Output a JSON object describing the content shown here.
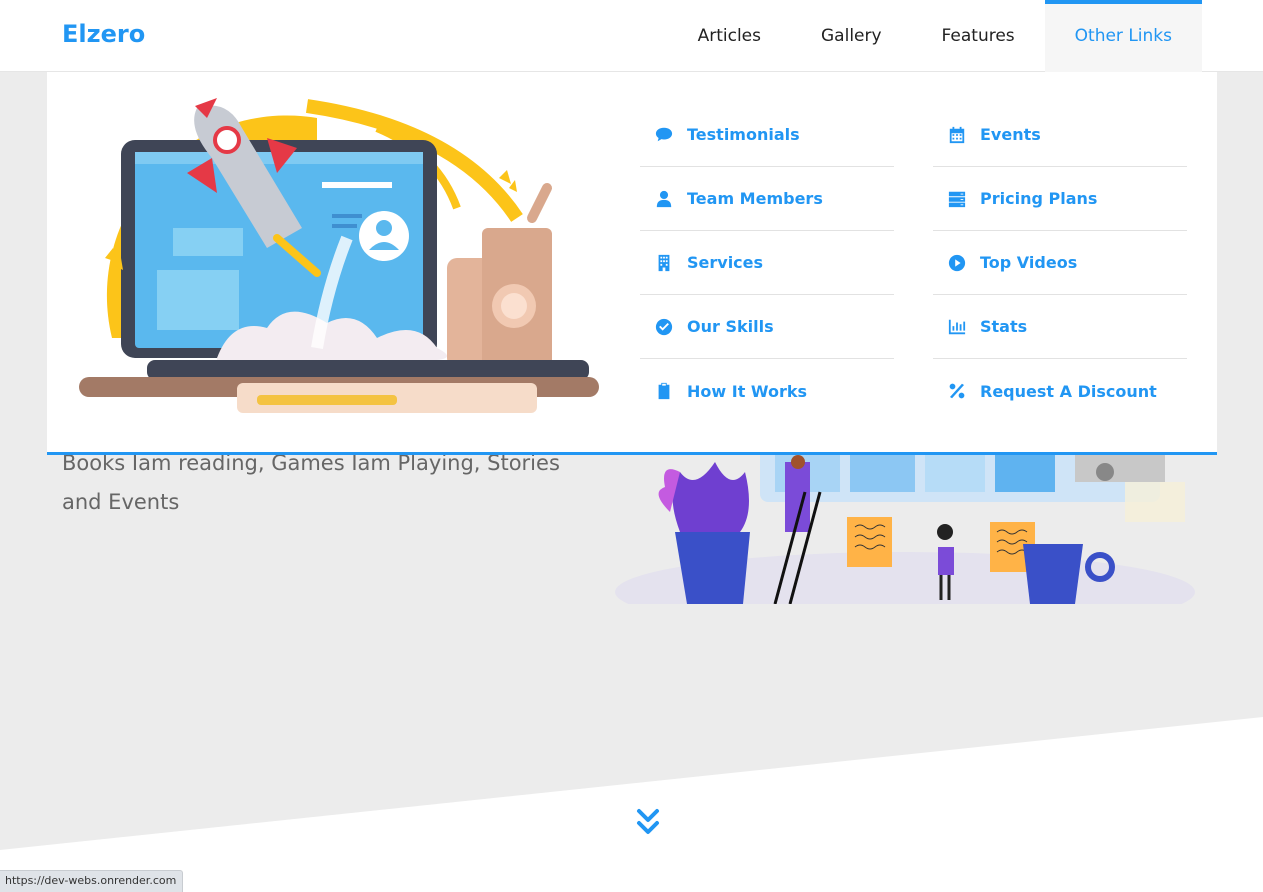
{
  "header": {
    "logo": "Elzero",
    "nav": [
      "Articles",
      "Gallery",
      "Features",
      "Other Links"
    ],
    "active_nav": "Other Links"
  },
  "hero": {
    "text": "Books Iam reading, Games Iam Playing, Stories and Events"
  },
  "mega_menu": {
    "column1": [
      {
        "label": "Testimonials",
        "icon": "comment-icon"
      },
      {
        "label": "Team Members",
        "icon": "user-icon"
      },
      {
        "label": "Services",
        "icon": "building-icon"
      },
      {
        "label": "Our Skills",
        "icon": "check-circle-icon"
      },
      {
        "label": "How It Works",
        "icon": "clipboard-icon"
      }
    ],
    "column2": [
      {
        "label": "Events",
        "icon": "calendar-icon"
      },
      {
        "label": "Pricing Plans",
        "icon": "server-icon"
      },
      {
        "label": "Top Videos",
        "icon": "play-circle-icon"
      },
      {
        "label": "Stats",
        "icon": "chart-bar-icon"
      },
      {
        "label": "Request A Discount",
        "icon": "percent-icon"
      }
    ]
  },
  "status_bar": {
    "url": "https://dev-webs.onrender.com"
  },
  "colors": {
    "accent": "#2196f3",
    "background": "#ececec"
  }
}
